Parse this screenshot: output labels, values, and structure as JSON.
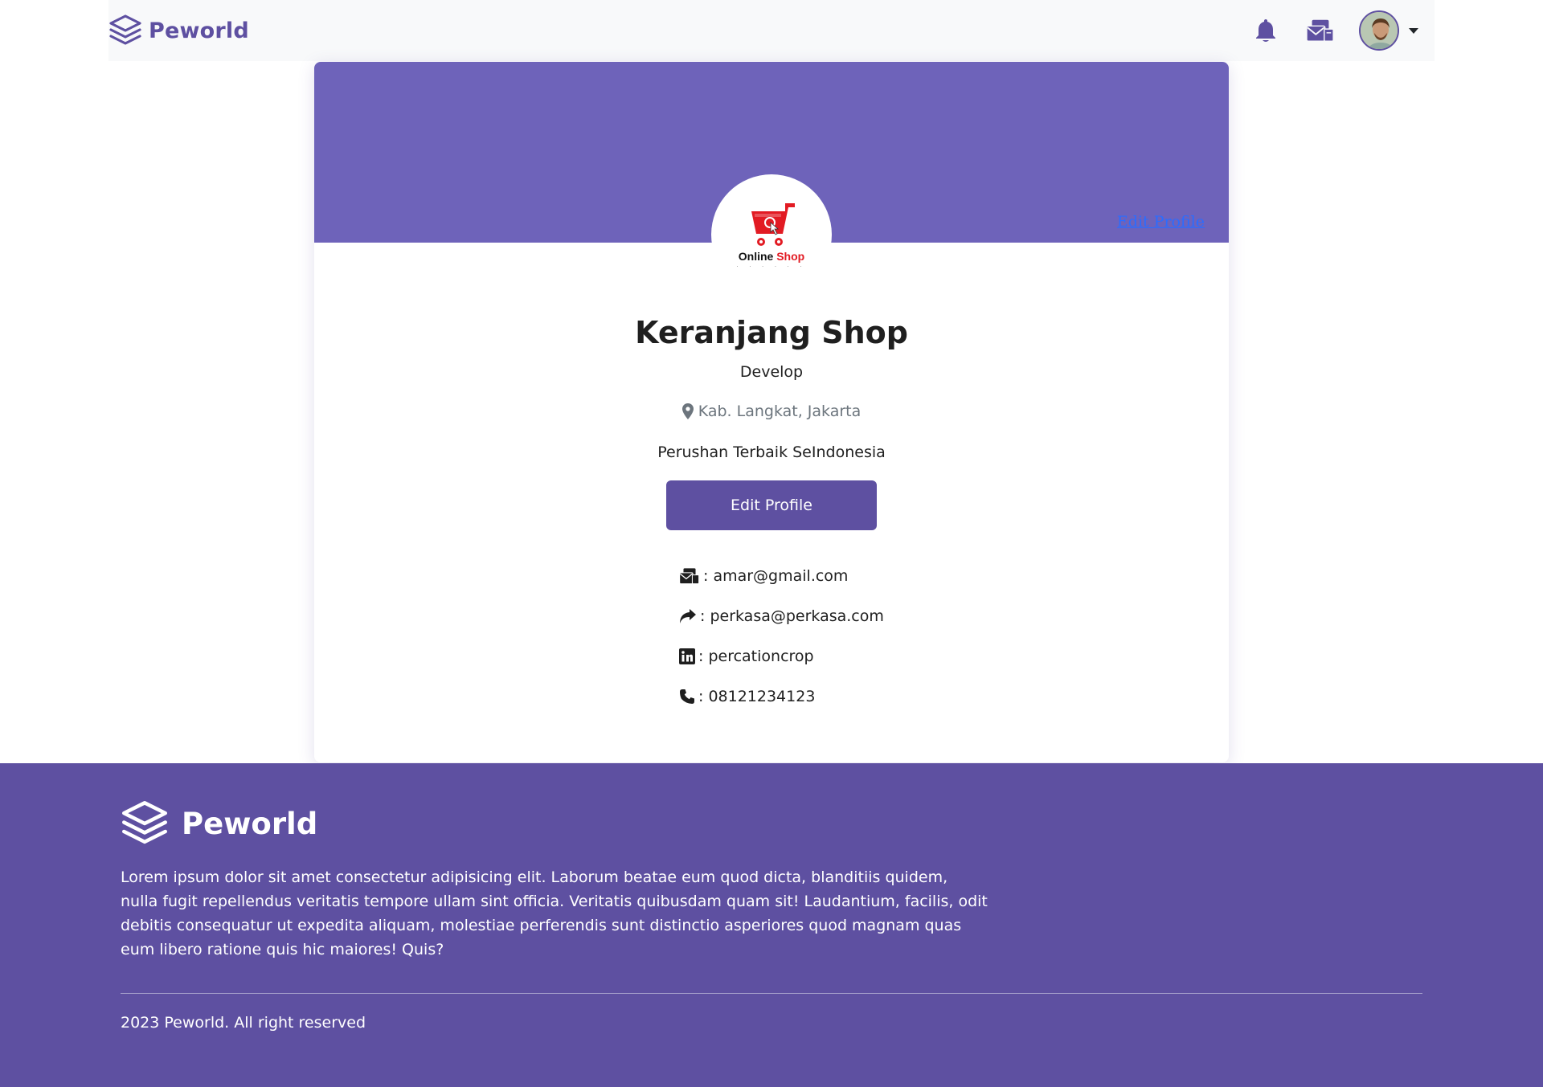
{
  "navbar": {
    "brand": "Peworld",
    "icons": [
      "bell-icon",
      "mail-icon",
      "avatar",
      "caret-down-icon"
    ]
  },
  "profile": {
    "banner_link": "Edit Profile",
    "logo": {
      "line1": "Online",
      "line2": "Shop"
    },
    "name": "Keranjang Shop",
    "role": "Develop",
    "location": "Kab. Langkat, Jakarta",
    "description": "Perushan Terbaik SeIndonesia",
    "edit_button": "Edit Profile",
    "contacts": [
      {
        "icon": "mail-icon",
        "text": ": amar@gmail.com"
      },
      {
        "icon": "share-icon",
        "text": ": perkasa@perkasa.com"
      },
      {
        "icon": "linkedin-icon",
        "text": ": percationcrop"
      },
      {
        "icon": "phone-icon",
        "text": ": 08121234123"
      }
    ]
  },
  "footer": {
    "brand": "Peworld",
    "text": "Lorem ipsum dolor sit amet consectetur adipisicing elit. Laborum beatae eum quod dicta, blanditiis quidem, nulla fugit repellendus veritatis tempore ullam sint officia. Veritatis quibusdam quam sit! Laudantium, facilis, odit debitis consequatur ut expedita aliquam, molestiae perferendis sunt distinctio asperiores quod magnam quas eum libero ratione quis hic maiores! Quis?",
    "copyright": "2023 Peworld. All right reserved"
  },
  "colors": {
    "brand": "#5e50a1",
    "banner": "#6e63ba",
    "link": "#2b6cff",
    "logo_red": "#e21b23"
  }
}
